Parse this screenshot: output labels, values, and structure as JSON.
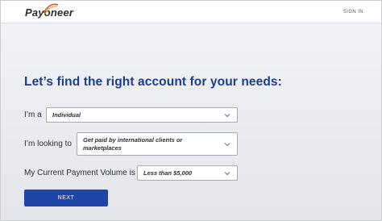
{
  "header": {
    "logo_text": "Payoneer",
    "signin_label": "SIGN IN"
  },
  "main": {
    "heading": "Let’s find the right account for your needs:",
    "fields": [
      {
        "label": "I’m a",
        "value": "Individual"
      },
      {
        "label": "I’m looking to",
        "value": "Get paid by international clients or marketplaces"
      },
      {
        "label": "My Current Payment Volume is",
        "value": "Less than $5,000"
      }
    ],
    "next_label": "NEXT"
  },
  "colors": {
    "brand_blue": "#1c3f8c",
    "button_blue": "#1f45a8"
  }
}
